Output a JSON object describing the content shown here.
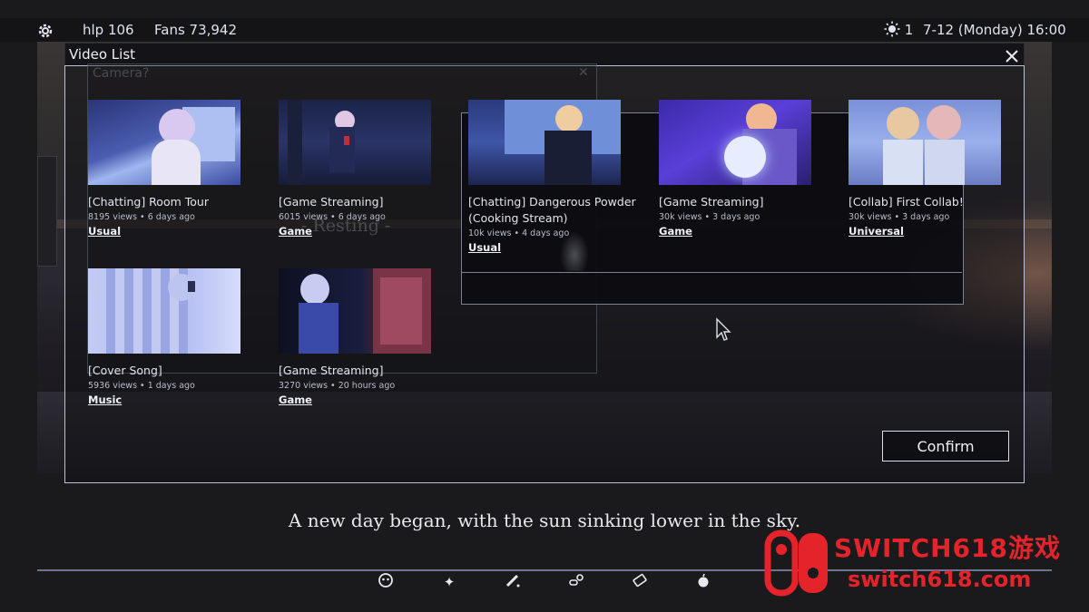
{
  "hud": {
    "settings_icon": "gear-icon",
    "hp": "hlp 106",
    "fans": "Fans 73,942",
    "weather_icon": "sun-icon",
    "weather_value": "1",
    "datetime": "7-12 (Monday) 16:00"
  },
  "window": {
    "title": "Video List",
    "close_icon": "close-icon"
  },
  "background": {
    "camera_text": "Camera?",
    "resting_text": "- Resting -"
  },
  "videos": [
    {
      "title": "[Chatting] Room Tour",
      "views": "8195 views",
      "ago": "6 days ago",
      "category": "Usual"
    },
    {
      "title": "[Game Streaming]",
      "views": "6015 views",
      "ago": "6 days ago",
      "category": "Game"
    },
    {
      "title": "[Chatting] Dangerous Powder (Cooking Stream)",
      "views": "10k views",
      "ago": "4 days ago",
      "category": "Usual"
    },
    {
      "title": "[Game Streaming]",
      "views": "30k views",
      "ago": "3 days ago",
      "category": "Game"
    },
    {
      "title": "[Collab] First Collab!",
      "views": "30k views",
      "ago": "3 days ago",
      "category": "Universal"
    },
    {
      "title": "[Cover Song]",
      "views": "5936 views",
      "ago": "1 days ago",
      "category": "Music"
    },
    {
      "title": "[Game Streaming]",
      "views": "3270 views",
      "ago": "20 hours ago",
      "category": "Game"
    }
  ],
  "confirm_label": "Confirm",
  "caption": "A new day began, with the sun sinking lower in the sky.",
  "toolbar": [
    "face-icon",
    "sparkle-icon",
    "pen-icon",
    "pills-icon",
    "ticket-icon",
    "apple-icon"
  ],
  "watermark": {
    "top": "SWITCH618游戏",
    "bottom": "switch618.com"
  },
  "colors": {
    "frame_border": "#b9c2da",
    "watermark_red": "#e4232b"
  }
}
